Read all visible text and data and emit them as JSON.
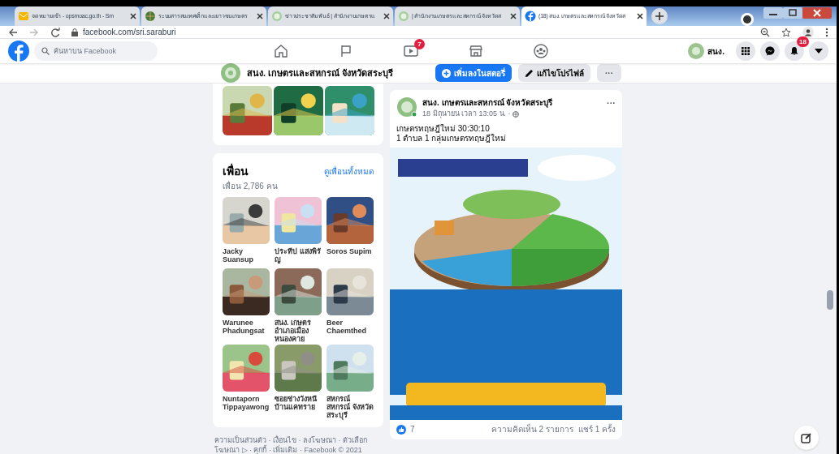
{
  "browser": {
    "tabs": [
      {
        "title": "จดหมายเข้า - opsmoac.go.th - Sm",
        "kind": "mail",
        "selected": false
      },
      {
        "title": "ระบบสารสนเทศเด็กและเยาวชนเกษตร",
        "kind": "globe",
        "selected": false
      },
      {
        "title": "ข่าวประชาสัมพันธ์ | สำนักงานเกษตรแ",
        "kind": "seal",
        "selected": false
      },
      {
        "title": "| สำนักงานเกษตรและสหกรณ์ จังหวัดส",
        "kind": "seal",
        "selected": false
      },
      {
        "title": "(18) สนง. เกษตรและสหกรณ์ จังหวัดส",
        "kind": "facebook",
        "selected": true
      }
    ],
    "url": "facebook.com/sri.saraburi"
  },
  "header": {
    "search": {
      "placeholder": "ค้นหาบน Facebook"
    },
    "nav": [
      {
        "kind": "home"
      },
      {
        "kind": "flag"
      },
      {
        "kind": "video",
        "badge": "7"
      },
      {
        "kind": "store"
      },
      {
        "kind": "groups"
      }
    ],
    "profile": "สนง.",
    "notifications_badge": "18"
  },
  "page_bar": {
    "name": "สนง. เกษตรและสหกรณ์ จังหวัดสระบุรี",
    "buttons": [
      {
        "kind": "story",
        "label": "เพิ่มลงในสตอรี่"
      },
      {
        "kind": "edit",
        "label": "แก้ไขโปรไฟล์"
      },
      {
        "kind": "more",
        "label": "···"
      }
    ]
  },
  "photos": [
    {
      "kind": "picture"
    },
    {
      "kind": "picture"
    },
    {
      "kind": "picture"
    }
  ],
  "friends": {
    "title": "เพื่อน",
    "see_all": "ดูเพื่อนทั้งหมด",
    "count": "เพื่อน 2,786 คน",
    "items": [
      {
        "name": "Jacky Suansup"
      },
      {
        "name": "ประทีป แสงพิรัญ"
      },
      {
        "name": "Soros Supim"
      },
      {
        "name": "Warunee Phadungsat"
      },
      {
        "name": "สนง. เกษตร อำเภอเมือง หนองคาย"
      },
      {
        "name": "Beer Chaemthed"
      },
      {
        "name": "Nuntaporn Tippayawong"
      },
      {
        "name": "ซอยช่างวังหนี บ้านแคทราย"
      },
      {
        "name": "สหกรณ์ สหกรณ์ จังหวัดสระบุรี"
      }
    ]
  },
  "footer": "ความเป็นส่วนตัว · เงื่อนไข · ลงโฆษณา · ตัวเลือกโฆษณา ▷ · คุกกี้ · เพิ่มเติม · Facebook © 2021",
  "post": {
    "author": "สนง. เกษตรและสหกรณ์ จังหวัดสระบุรี",
    "time": "18 มิถุนายน เวลา 13:05 น. ·",
    "more": "···",
    "lines": [
      "เกษตรทฤษฎีใหม่ 30:30:10",
      "1 ตำบล 1 กลุ่มเกษตรทฤษฎีใหม่"
    ],
    "image": {
      "kind": "picture"
    },
    "likes": "7",
    "comments": "ความคิดเห็น 2 รายการ",
    "shares": "แชร์ 1 ครั้ง"
  }
}
